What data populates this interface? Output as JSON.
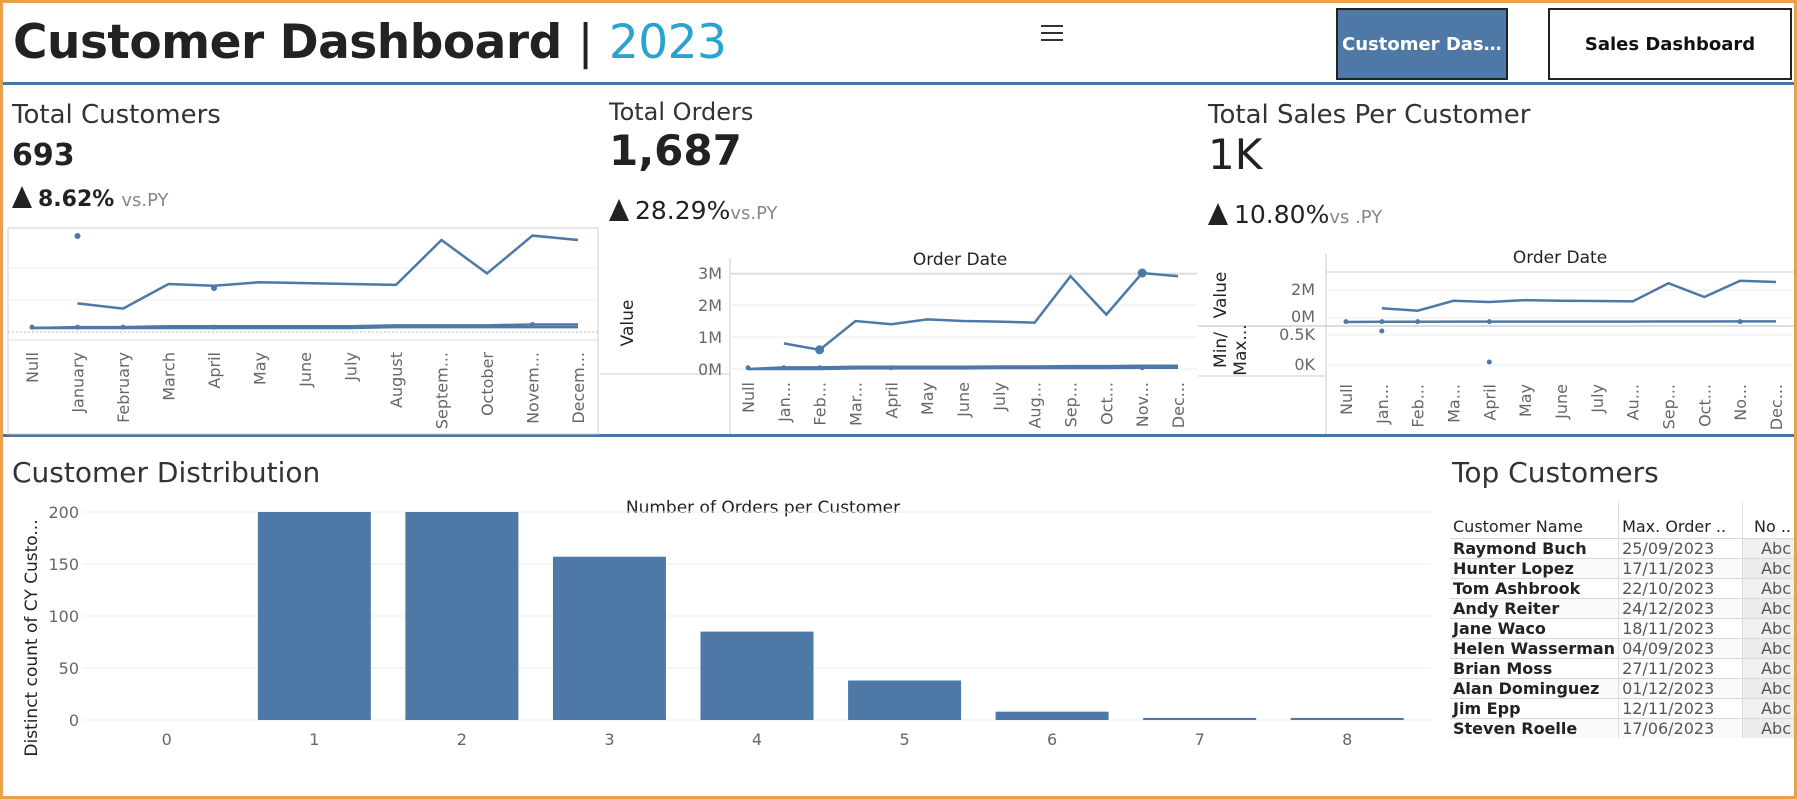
{
  "header": {
    "title": "Customer Dashboard",
    "separator": "|",
    "year": "2023",
    "nav": [
      {
        "label": "Customer Dashboa...",
        "active": true
      },
      {
        "label": "Sales Dashboard",
        "active": false
      }
    ]
  },
  "kpis": {
    "customers": {
      "title": "Total Customers",
      "value": "693",
      "delta": "8.62%",
      "vs": "vs.PY"
    },
    "orders": {
      "title": "Total Orders",
      "value": "1,687",
      "delta": "28.29%",
      "vs": "vs.PY"
    },
    "sales": {
      "title": "Total Sales Per Customer",
      "value": "1K",
      "delta": "10.80%",
      "vs": "vs .PY"
    }
  },
  "colors": {
    "accent": "#4e79a7",
    "year": "#2aa3d0",
    "divider": "#4a74a4"
  },
  "months_customers": [
    "Null",
    "January",
    "February",
    "March",
    "April",
    "May",
    "June",
    "July",
    "August",
    "Septem...",
    "October",
    "Novem...",
    "Decem..."
  ],
  "months_orders": [
    "Null",
    "Jan...",
    "Feb...",
    "Mar...",
    "April",
    "May",
    "June",
    "July",
    "Aug...",
    "Sep...",
    "Oct...",
    "Nov...",
    "Dec..."
  ],
  "months_sales": [
    "Null",
    "Jan...",
    "Feb...",
    "Ma...",
    "April",
    "May",
    "June",
    "July",
    "Au...",
    "Sep...",
    "Oct...",
    "No...",
    "Dec..."
  ],
  "orders_chart": {
    "header": "Order Date",
    "ylabel": "Value",
    "ticks": [
      "3M",
      "2M",
      "1M",
      "0M"
    ]
  },
  "sales_chart": {
    "header": "Order Date",
    "ylabel_top": "Value",
    "ylabel_bottom": "Min/ Max...",
    "ticks_top": [
      "2M",
      "0M"
    ],
    "ticks_bottom": [
      "0.5K",
      "0K"
    ]
  },
  "chart_data": [
    {
      "type": "line",
      "title": "Total Customers",
      "x": [
        "Null",
        "January",
        "February",
        "March",
        "April",
        "May",
        "June",
        "July",
        "August",
        "Septem...",
        "October",
        "Novem...",
        "Decem..."
      ],
      "series": [
        {
          "values": [
            null,
            28,
            22,
            50,
            48,
            52,
            51,
            50,
            49,
            100,
            62,
            105,
            100
          ]
        },
        {
          "values": [
            0,
            1,
            1,
            2,
            2,
            2,
            2,
            2,
            3,
            3,
            3,
            4,
            4
          ]
        },
        {
          "values": [
            0,
            0,
            0,
            0,
            0,
            0,
            0,
            0,
            1,
            1,
            1,
            1,
            1
          ]
        }
      ]
    },
    {
      "type": "line",
      "title": "Total Orders",
      "xlabel": "Order Date",
      "ylabel": "Value",
      "ylim": [
        0,
        3
      ],
      "x": [
        "Null",
        "Jan...",
        "Feb...",
        "Mar...",
        "April",
        "May",
        "June",
        "July",
        "Aug...",
        "Sep...",
        "Oct...",
        "Nov...",
        "Dec..."
      ],
      "series": [
        {
          "values": [
            null,
            0.8,
            0.6,
            1.5,
            1.4,
            1.55,
            1.5,
            1.48,
            1.45,
            2.9,
            1.7,
            3.0,
            2.9
          ]
        },
        {
          "values": [
            0,
            0.05,
            0.05,
            0.07,
            0.07,
            0.07,
            0.07,
            0.08,
            0.08,
            0.09,
            0.09,
            0.1,
            0.1
          ]
        },
        {
          "values": [
            0,
            0,
            0,
            0.02,
            0.02,
            0.02,
            0.02,
            0.03,
            0.03,
            0.03,
            0.03,
            0.04,
            0.04
          ]
        }
      ]
    },
    {
      "type": "line",
      "title": "Total Sales Per Customer",
      "xlabel": "Order Date",
      "ylabel": "Value",
      "x": [
        "Null",
        "Jan...",
        "Feb...",
        "Ma...",
        "April",
        "May",
        "June",
        "July",
        "Au...",
        "Sep...",
        "Oct...",
        "No...",
        "Dec..."
      ],
      "series": [
        {
          "values": [
            null,
            1.1,
            0.9,
            1.7,
            1.6,
            1.75,
            1.7,
            1.68,
            1.65,
            3.1,
            2.0,
            3.3,
            3.2
          ]
        },
        {
          "values": [
            0,
            0.02,
            0.02,
            0.03,
            0.03,
            0.03,
            0.03,
            0.03,
            0.03,
            0.04,
            0.04,
            0.05,
            0.05
          ]
        }
      ]
    },
    {
      "type": "bar",
      "title": "Number of Orders per Customer",
      "ylabel": "Distinct count of CY Custo...",
      "categories": [
        "0",
        "1",
        "2",
        "3",
        "4",
        "5",
        "6",
        "7",
        "8"
      ],
      "values": [
        0,
        200,
        200,
        157,
        85,
        38,
        8,
        2,
        2
      ],
      "ylim": [
        0,
        200
      ],
      "yticks": [
        "200",
        "150",
        "100",
        "50",
        "0"
      ]
    }
  ],
  "distribution": {
    "title": "Customer Distribution"
  },
  "top_customers": {
    "title": "Top Customers",
    "columns": [
      "Customer Name",
      "Max. Order ..",
      "No .."
    ],
    "rows": [
      {
        "name": "Raymond Buch",
        "date": "25/09/2023",
        "abc": "Abc"
      },
      {
        "name": "Hunter Lopez",
        "date": "17/11/2023",
        "abc": "Abc"
      },
      {
        "name": "Tom Ashbrook",
        "date": "22/10/2023",
        "abc": "Abc"
      },
      {
        "name": "Andy Reiter",
        "date": "24/12/2023",
        "abc": "Abc"
      },
      {
        "name": "Jane Waco",
        "date": "18/11/2023",
        "abc": "Abc"
      },
      {
        "name": "Helen Wasserman",
        "date": "04/09/2023",
        "abc": "Abc"
      },
      {
        "name": "Brian Moss",
        "date": "27/11/2023",
        "abc": "Abc"
      },
      {
        "name": "Alan Dominguez",
        "date": "01/12/2023",
        "abc": "Abc"
      },
      {
        "name": "Jim Epp",
        "date": "12/11/2023",
        "abc": "Abc"
      },
      {
        "name": "Steven Roelle",
        "date": "17/06/2023",
        "abc": "Abc"
      }
    ]
  }
}
